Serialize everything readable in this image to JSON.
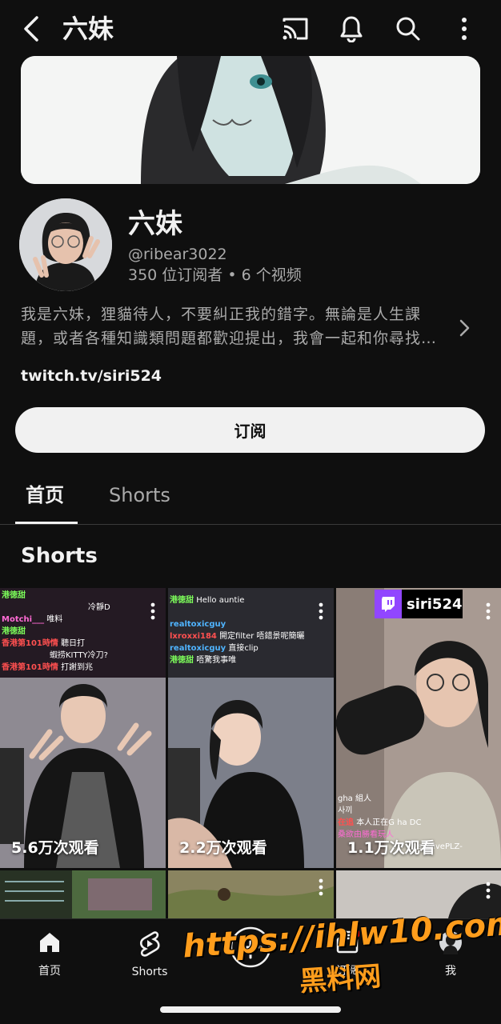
{
  "header": {
    "title": "六妹",
    "back_icon": "chevron-left-icon",
    "actions": [
      "cast-icon",
      "bell-icon",
      "search-icon",
      "more-vert-icon"
    ]
  },
  "channel": {
    "name": "六妹",
    "handle": "@ribear3022",
    "stats": "350 位订阅者 • 6 个视频",
    "description_line1": "我是六妹，狸貓待人，不要糾正我的錯字。無論是人生課",
    "description_line2": "題，或者各種知識類問題都歡迎提出，我會一起和你尋找…",
    "link": "twitch.tv/siri524",
    "subscribe_label": "订阅"
  },
  "tabs": [
    {
      "label": "首页",
      "active": true
    },
    {
      "label": "Shorts",
      "active": false
    }
  ],
  "shorts_section": {
    "title": "Shorts",
    "items": [
      {
        "views": "5.6万次观看",
        "chat": [
          {
            "user": "港徳甜",
            "text": ""
          },
          {
            "user": "",
            "text": "冷靜D"
          },
          {
            "user": "Motchi___",
            "text": "唯料"
          },
          {
            "user": "港徳甜",
            "text": ""
          },
          {
            "user": "香港第101時情",
            "text": "聽日打"
          },
          {
            "user": "",
            "text": "蝦捞KITTY冷刀?"
          },
          {
            "user": "香港第101時情",
            "text": "打謝到兆"
          }
        ]
      },
      {
        "views": "2.2万次观看",
        "chat": [
          {
            "user": "港徳甜",
            "text": "Hello auntie"
          },
          {
            "user": "realtoxicguy",
            "text": ""
          },
          {
            "user": "lxroxxi184",
            "text": "開定filter 唔錯景呢簡曬"
          },
          {
            "user": "realtoxicguy",
            "text": "直接clip"
          },
          {
            "user": "港徳甜",
            "text": "唔驚我事唯"
          }
        ]
      },
      {
        "views": "1.1万次观看",
        "badge": "siri524",
        "chat": [
          {
            "user": "",
            "text": "gha 組人"
          },
          {
            "user": "",
            "text": "사끼"
          },
          {
            "user": "在追",
            "text": "本人正在G ha DC"
          },
          {
            "user": "",
            "text": "桑欲由勝看玩人"
          },
          {
            "user": "",
            "text": "seGivePLZ-"
          }
        ]
      }
    ]
  },
  "bottom_nav": [
    {
      "label": "首页",
      "icon": "home-icon"
    },
    {
      "label": "Shorts",
      "icon": "shorts-icon"
    },
    {
      "label": "",
      "icon": "create-plus-icon"
    },
    {
      "label": "订阅",
      "icon": "subscriptions-icon"
    },
    {
      "label": "我",
      "icon": "profile-icon"
    }
  ],
  "watermark": {
    "line1": "https://ihlw10.com",
    "line2": "黑料网"
  },
  "colors": {
    "background": "#0f0f0f",
    "text": "#f1f1f1",
    "secondary_text": "#aaaaaa",
    "twitch_purple": "#9146ff",
    "watermark": "#ff9d1c"
  }
}
